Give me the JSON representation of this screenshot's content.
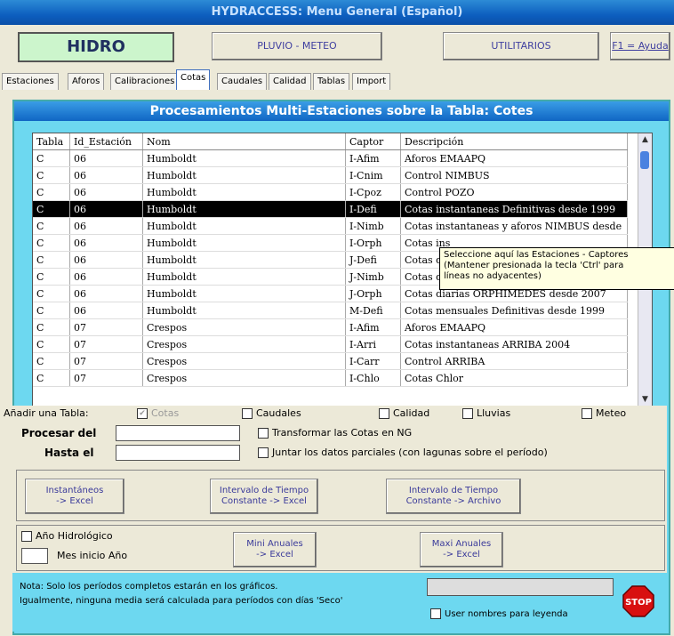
{
  "window": {
    "title": "HYDRACCESS: Menu General (Español)"
  },
  "topbar": {
    "hidro": "HIDRO",
    "pluvio": "PLUVIO - METEO",
    "utilitarios": "UTILITARIOS",
    "help": "F1 = Ayuda"
  },
  "tabs": [
    "Estaciones",
    "Aforos",
    "Calibraciones",
    "Cotas",
    "Caudales",
    "Calidad",
    "Tablas",
    "Import"
  ],
  "active_tab": "Cotas",
  "panel": {
    "title": "Procesamientos Multi-Estaciones sobre la Tabla: Cotes"
  },
  "grid": {
    "headers": [
      "Tabla",
      "Id_Estación",
      "Nom",
      "Captor",
      "Descripción"
    ],
    "rows": [
      [
        "C",
        "06",
        "Humboldt",
        "I-Afim",
        "Aforos EMAAPQ"
      ],
      [
        "C",
        "06",
        "Humboldt",
        "I-Cnim",
        "Control NIMBUS"
      ],
      [
        "C",
        "06",
        "Humboldt",
        "I-Cpoz",
        "Control POZO"
      ],
      [
        "C",
        "06",
        "Humboldt",
        "I-Defi",
        "Cotas instantaneas Definitivas desde 1999"
      ],
      [
        "C",
        "06",
        "Humboldt",
        "I-Nimb",
        "Cotas instantaneas y aforos NIMBUS desde"
      ],
      [
        "C",
        "06",
        "Humboldt",
        "I-Orph",
        "Cotas ins"
      ],
      [
        "C",
        "06",
        "Humboldt",
        "J-Defi",
        "Cotas dia"
      ],
      [
        "C",
        "06",
        "Humboldt",
        "J-Nimb",
        "Cotas diarias NIMBUS desde 1999"
      ],
      [
        "C",
        "06",
        "Humboldt",
        "J-Orph",
        "Cotas diarias ORPHIMEDES desde 2007"
      ],
      [
        "C",
        "06",
        "Humboldt",
        "M-Defi",
        "Cotas mensuales Definitivas desde 1999"
      ],
      [
        "C",
        "07",
        "Crespos",
        "I-Afim",
        "Aforos EMAAPQ"
      ],
      [
        "C",
        "07",
        "Crespos",
        "I-Arri",
        "Cotas instantaneas ARRIBA 2004"
      ],
      [
        "C",
        "07",
        "Crespos",
        "I-Carr",
        "Control ARRIBA"
      ],
      [
        "C",
        "07",
        "Crespos",
        "I-Chlo",
        "Cotas Chlor"
      ]
    ],
    "selected_index": 3
  },
  "tooltip": {
    "line1": "Seleccione aquí las Estaciones - Captores",
    "line2": "(Mantener presionada la tecla 'Ctrl' para",
    "line3": "líneas no adyacentes)"
  },
  "add_table": {
    "label": "Añadir una Tabla:",
    "options": [
      {
        "label": "Cotas",
        "checked": true
      },
      {
        "label": "Caudales",
        "checked": false
      },
      {
        "label": "Calidad",
        "checked": false
      },
      {
        "label": "Lluvias",
        "checked": false
      },
      {
        "label": "Meteo",
        "checked": false
      }
    ]
  },
  "period": {
    "from_label": "Procesar del",
    "to_label": "Hasta el",
    "from_value": "",
    "to_value": "",
    "transform_label": "Transformar las Cotas en NG",
    "join_label": "Juntar los datos parciales (con lagunas sobre el período)"
  },
  "buttons": {
    "instant": [
      "Instantáneos",
      "-> Excel"
    ],
    "interval_excel": [
      "Intervalo de Tiempo",
      "Constante -> Excel"
    ],
    "interval_file": [
      "Intervalo de Tiempo",
      "Constante -> Archivo"
    ],
    "mini": [
      "Mini Anuales",
      "-> Excel"
    ],
    "maxi": [
      "Maxi Anuales",
      "-> Excel"
    ]
  },
  "year": {
    "hydro_label": "Año Hidrológico",
    "month_label": "Mes inicio Año",
    "month_value": ""
  },
  "note": {
    "line1": "Nota: Solo los períodos completos estarán en los gráficos.",
    "line2": "Igualmente, ninguna media será calculada para períodos con días 'Seco'",
    "legend_label": "User nombres para leyenda",
    "stop": "STOP"
  }
}
